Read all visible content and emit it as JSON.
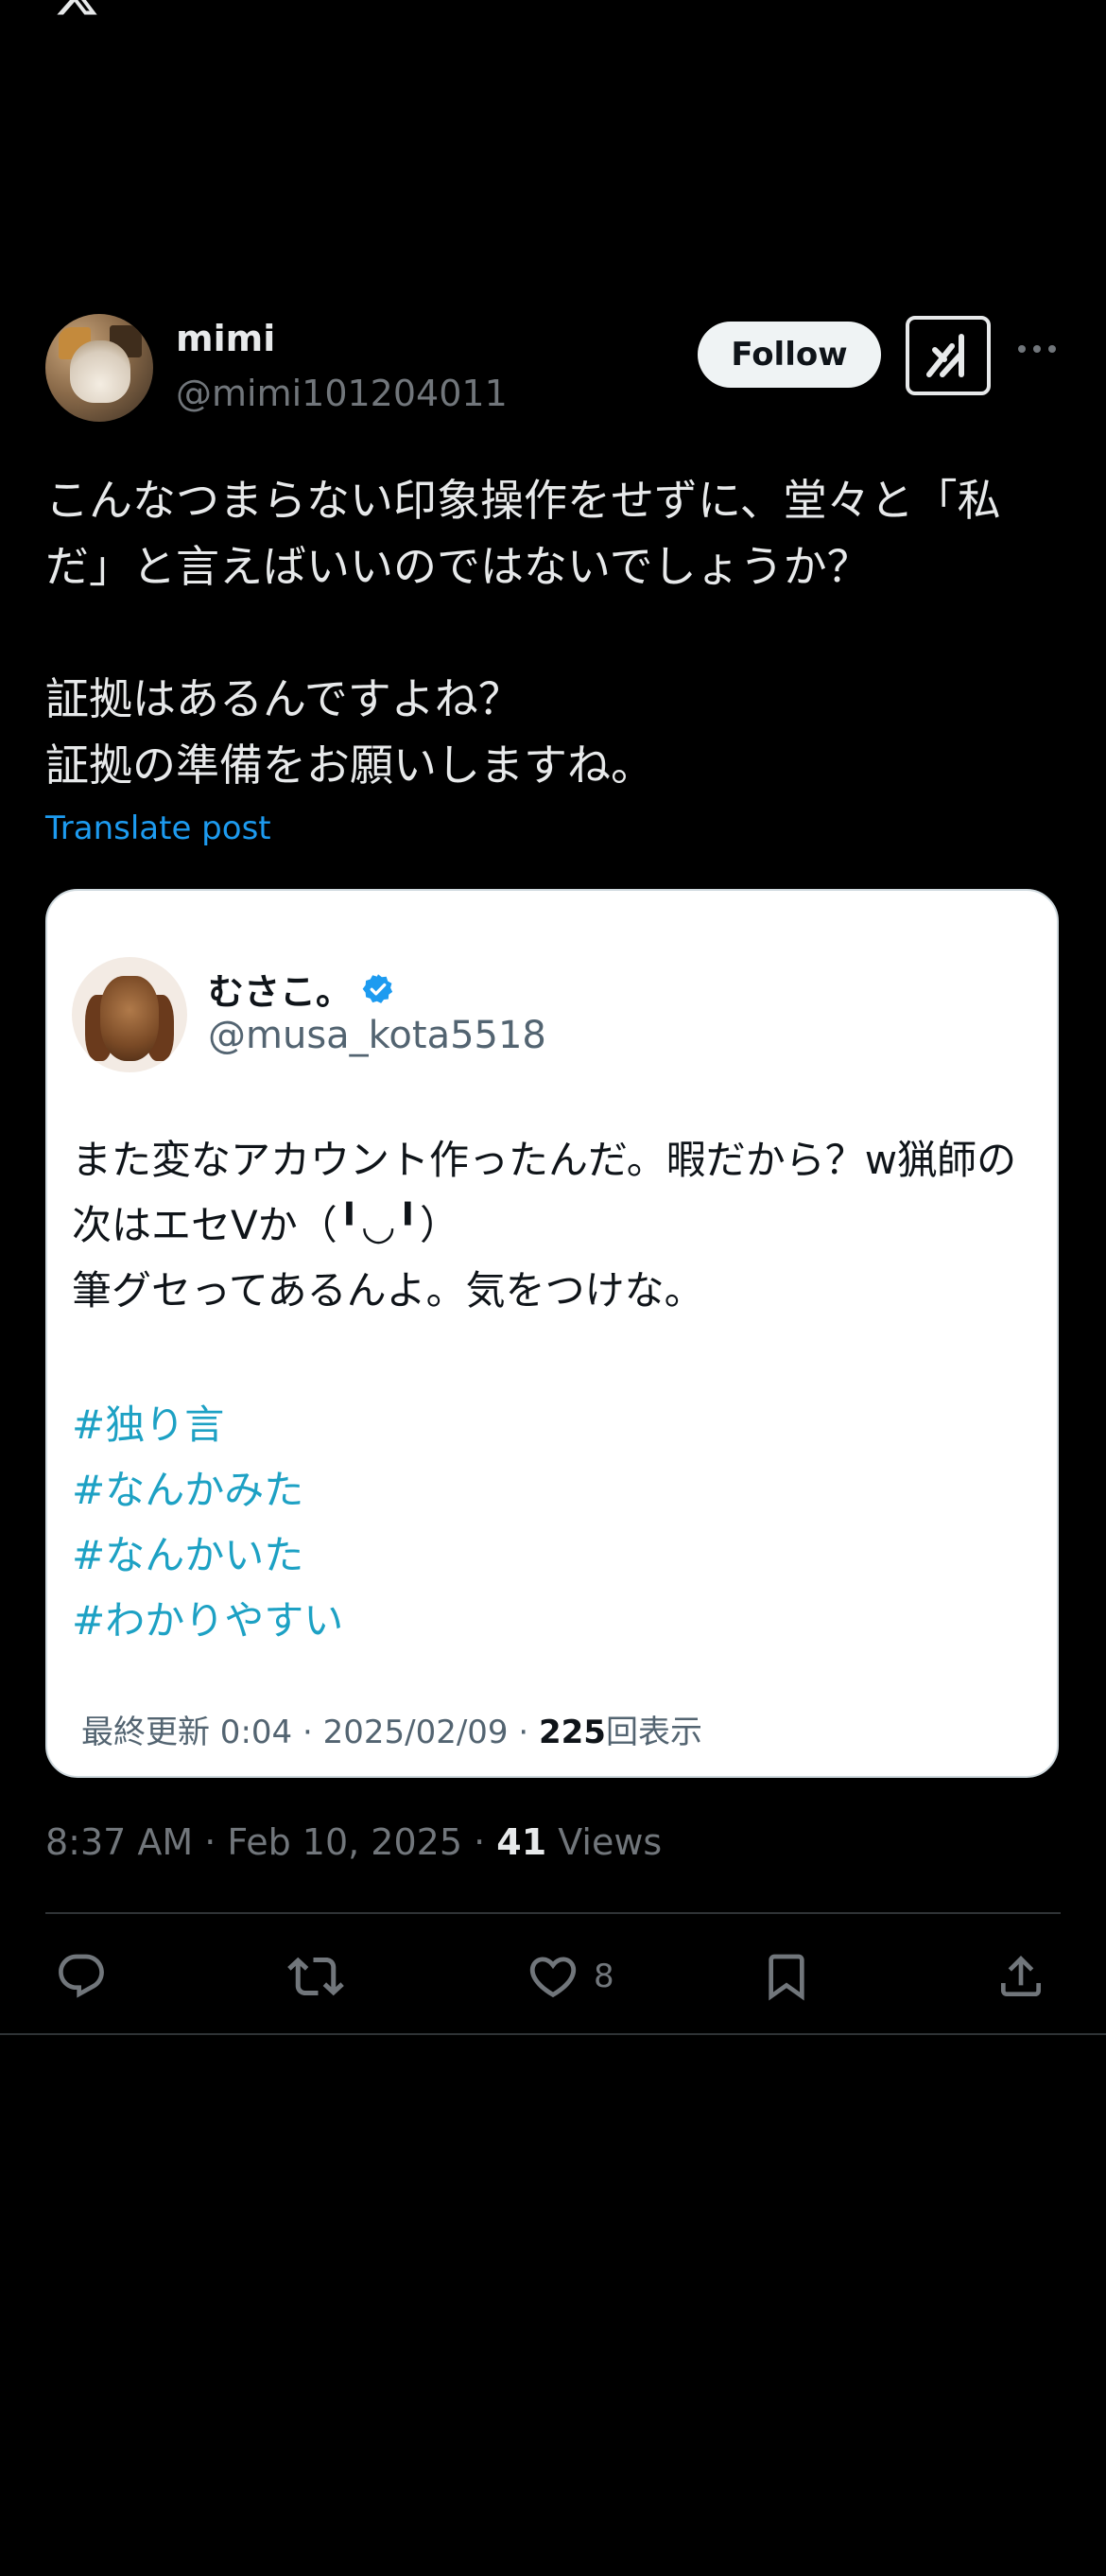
{
  "header": {
    "logo_icon": "x-logo-icon"
  },
  "post": {
    "author_name": "mimi",
    "author_handle": "@mimi101204011",
    "follow_label": "Follow",
    "text": "こんなつまらない印象操作をせずに、堂々と「私だ」と言えばいいのではないでしょうか？\n\n証拠はあるんですよね？\n証拠の準備をお願いしますね。",
    "translate_label": "Translate post",
    "time": "8:37 AM · Feb 10, 2025 · ",
    "views_count": "41",
    "views_label": "Views",
    "likes_count": "8"
  },
  "quote": {
    "name": "むさこ。",
    "handle": "@musa_kota5518",
    "text": "また変なアカウント作ったんだ。暇だから？w猟師の次はエセVか（╹◡╹）\n筆グセってあるんよ。気をつけな。",
    "hashtags": [
      "#独り言",
      "#なんかみた",
      "#なんかいた",
      "#わかりやすい"
    ],
    "footer_prefix": "最終更新 0:04 · 2025/02/09  · ",
    "footer_views": "225",
    "footer_views_label": "回表示"
  },
  "colors": {
    "background": "#000000",
    "link": "#1d9bf0",
    "hashtag": "#1da1c4",
    "verified": "#1d9bf0"
  }
}
